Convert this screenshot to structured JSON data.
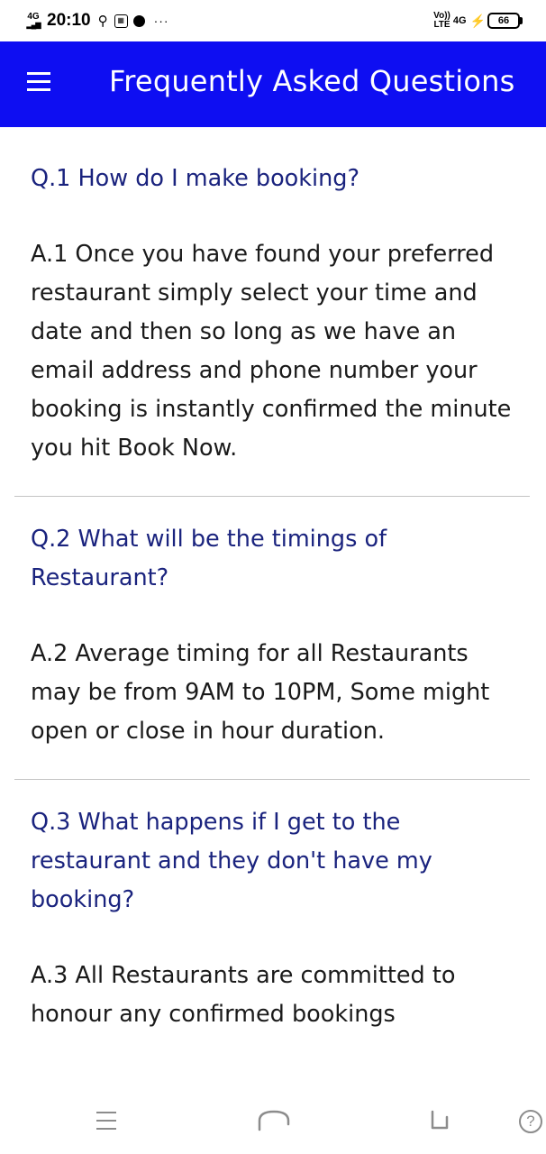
{
  "status_bar": {
    "network": "4G",
    "time": "20:10",
    "more": "···",
    "volte": "Vo)) LTE",
    "network_right": "4G",
    "battery": "66"
  },
  "app_bar": {
    "title": "Frequently Asked Questions",
    "color": "#0e0ef2"
  },
  "faq": [
    {
      "question": "Q.1 How do I make booking?",
      "answer": "A.1 Once you have found your preferred restaurant simply select your time and date and then so long as we have an email address and phone number your booking is instantly confirmed the minute you hit Book Now."
    },
    {
      "question": "Q.2 What will be the timings of Restaurant?",
      "answer": "A.2 Average timing for all Restaurants may be from 9AM to 10PM, Some might open or close in hour duration."
    },
    {
      "question": "Q.3 What happens if I get to the restaurant and they don't have my booking?",
      "answer": "A.3 All Restaurants are committed to honour any confirmed bookings"
    }
  ],
  "colors": {
    "question": "#1a237e",
    "answer": "#1a1a1a",
    "divider": "#c4c4c4"
  },
  "nav_bar": {
    "help": "?"
  }
}
